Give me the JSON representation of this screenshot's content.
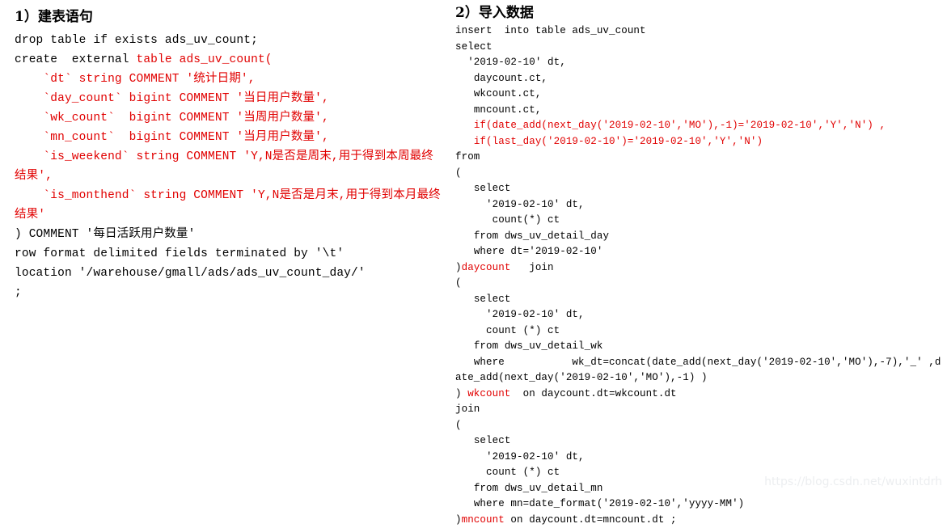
{
  "page": {
    "background": "#ffffff",
    "text_color": "#000000",
    "accent_color": "#e10000",
    "watermark_color": "#eceef0"
  },
  "left": {
    "title": "1）建表语句",
    "lines": [
      [
        {
          "t": "drop table if exists ads_uv_count;",
          "c": "k"
        }
      ],
      [
        {
          "t": "create  external ",
          "c": "k"
        },
        {
          "t": "table ads_uv_count(",
          "c": "r"
        }
      ],
      [
        {
          "t": "    `dt` string COMMENT '统计日期',",
          "c": "r"
        }
      ],
      [
        {
          "t": "    `day_count` bigint COMMENT '当日用户数量',",
          "c": "r"
        }
      ],
      [
        {
          "t": "    `wk_count`  bigint COMMENT '当周用户数量',",
          "c": "r"
        }
      ],
      [
        {
          "t": "    `mn_count`  bigint COMMENT '当月用户数量',",
          "c": "r"
        }
      ],
      [
        {
          "t": "    `is_weekend` string COMMENT 'Y,N是否是周末,用于得到本周最终结果',",
          "c": "r"
        }
      ],
      [
        {
          "t": "    `is_monthend` string COMMENT 'Y,N是否是月末,用于得到本月最终结果'",
          "c": "r"
        }
      ],
      [
        {
          "t": ") COMMENT '每日活跃用户数量'",
          "c": "k"
        }
      ],
      [
        {
          "t": "row format delimited fields terminated by '\\t'",
          "c": "k"
        }
      ],
      [
        {
          "t": "location '/warehouse/gmall/ads/ads_uv_count_day/'",
          "c": "k"
        }
      ],
      [
        {
          "t": ";",
          "c": "k"
        }
      ]
    ]
  },
  "right": {
    "title": "2）导入数据",
    "lines": [
      [
        {
          "t": "insert  into table ads_uv_count",
          "c": "k"
        }
      ],
      [
        {
          "t": "select",
          "c": "k"
        }
      ],
      [
        {
          "t": "  '2019-02-10' dt,",
          "c": "k"
        }
      ],
      [
        {
          "t": "   daycount.ct,",
          "c": "k"
        }
      ],
      [
        {
          "t": "   wkcount.ct,",
          "c": "k"
        }
      ],
      [
        {
          "t": "   mncount.ct,",
          "c": "k"
        }
      ],
      [
        {
          "t": "   if(date_add(next_day('2019-02-10','MO'),-1)='2019-02-10','Y','N') ,",
          "c": "r"
        }
      ],
      [
        {
          "t": "   if(last_day('2019-02-10')='2019-02-10','Y','N')",
          "c": "r"
        }
      ],
      [
        {
          "t": "from",
          "c": "k"
        }
      ],
      [
        {
          "t": "(",
          "c": "k"
        }
      ],
      [
        {
          "t": "   select",
          "c": "k"
        }
      ],
      [
        {
          "t": "     '2019-02-10' dt,",
          "c": "k"
        }
      ],
      [
        {
          "t": "      count(*) ct",
          "c": "k"
        }
      ],
      [
        {
          "t": "   from dws_uv_detail_day",
          "c": "k"
        }
      ],
      [
        {
          "t": "   where dt='2019-02-10'",
          "c": "k"
        }
      ],
      [
        {
          "t": ")",
          "c": "k"
        },
        {
          "t": "daycount",
          "c": "r"
        },
        {
          "t": "   join",
          "c": "k"
        }
      ],
      [
        {
          "t": "(",
          "c": "k"
        }
      ],
      [
        {
          "t": "   select",
          "c": "k"
        }
      ],
      [
        {
          "t": "     '2019-02-10' dt,",
          "c": "k"
        }
      ],
      [
        {
          "t": "     count (*) ct",
          "c": "k"
        }
      ],
      [
        {
          "t": "   from dws_uv_detail_wk",
          "c": "k"
        }
      ],
      [
        {
          "t": "   where           wk_dt=concat(date_add(next_day('2019-02-10','MO'),-7),'_' ,date_add(next_day('2019-02-10','MO'),-1) )",
          "c": "k"
        }
      ],
      [
        {
          "t": ") ",
          "c": "k"
        },
        {
          "t": "wkcount",
          "c": "r"
        },
        {
          "t": "  on daycount.dt=wkcount.dt",
          "c": "k"
        }
      ],
      [
        {
          "t": "join",
          "c": "k"
        }
      ],
      [
        {
          "t": "(",
          "c": "k"
        }
      ],
      [
        {
          "t": "   select",
          "c": "k"
        }
      ],
      [
        {
          "t": "     '2019-02-10' dt,",
          "c": "k"
        }
      ],
      [
        {
          "t": "     count (*) ct",
          "c": "k"
        }
      ],
      [
        {
          "t": "   from dws_uv_detail_mn",
          "c": "k"
        }
      ],
      [
        {
          "t": "   where mn=date_format('2019-02-10','yyyy-MM')",
          "c": "k"
        }
      ],
      [
        {
          "t": ")",
          "c": "k"
        },
        {
          "t": "mncount",
          "c": "r"
        },
        {
          "t": " on daycount.dt=mncount.dt ;",
          "c": "k"
        }
      ]
    ]
  },
  "watermark": {
    "text": "https://blog.csdn.net/wuxintdrh"
  }
}
